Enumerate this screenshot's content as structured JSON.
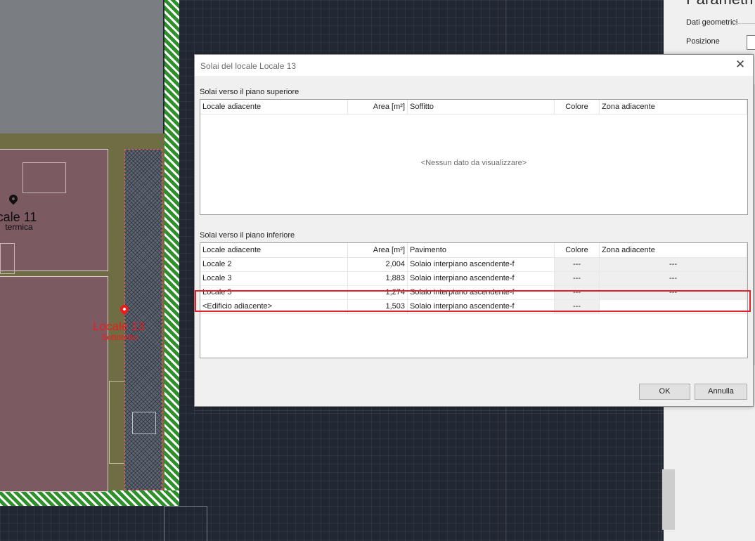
{
  "dialog": {
    "title": "Solai del locale Locale 13",
    "close_icon": "close-icon",
    "upper": {
      "label": "Solai verso il piano superiore",
      "columns": [
        "Locale adiacente",
        "Area [m²]",
        "Soffitto",
        "Colore",
        "Zona adiacente"
      ],
      "empty_message": "<Nessun dato da visualizzare>"
    },
    "lower": {
      "label": "Solai verso il piano inferiore",
      "columns": [
        "Locale adiacente",
        "Area [m²]",
        "Pavimento",
        "Colore",
        "Zona adiacente"
      ],
      "rows": [
        {
          "locale": "Locale 2",
          "area": "2,004",
          "solaio": "Solaio interpiano ascendente-f",
          "colore": "---",
          "zona": "---"
        },
        {
          "locale": "Locale 3",
          "area": "1,883",
          "solaio": "Solaio interpiano ascendente-f",
          "colore": "---",
          "zona": "---"
        },
        {
          "locale": "Locale 5",
          "area": "1,274",
          "solaio": "Solaio interpiano ascendente-f",
          "colore": "---",
          "zona": "---"
        },
        {
          "locale": "<Edificio adiacente>",
          "area": "1,503",
          "solaio": "Solaio interpiano ascendente-f",
          "colore": "---",
          "zona": ""
        }
      ]
    },
    "buttons": {
      "ok": "OK",
      "cancel": "Annulla"
    }
  },
  "right_panel": {
    "title": "Parametri l",
    "section": "Dati geometrici",
    "position_label": "Posizione"
  },
  "cad": {
    "locale_11": {
      "name": "cale 11",
      "sub": "termica"
    },
    "locale_13": {
      "name": "Locale 13",
      "sub": "Sottotetto"
    }
  },
  "colors": {
    "highlight": "#e4202d",
    "wall_green": "#2f8f2a",
    "room_pink": "#7c5a61",
    "selected_label": "#ee1c1c"
  }
}
